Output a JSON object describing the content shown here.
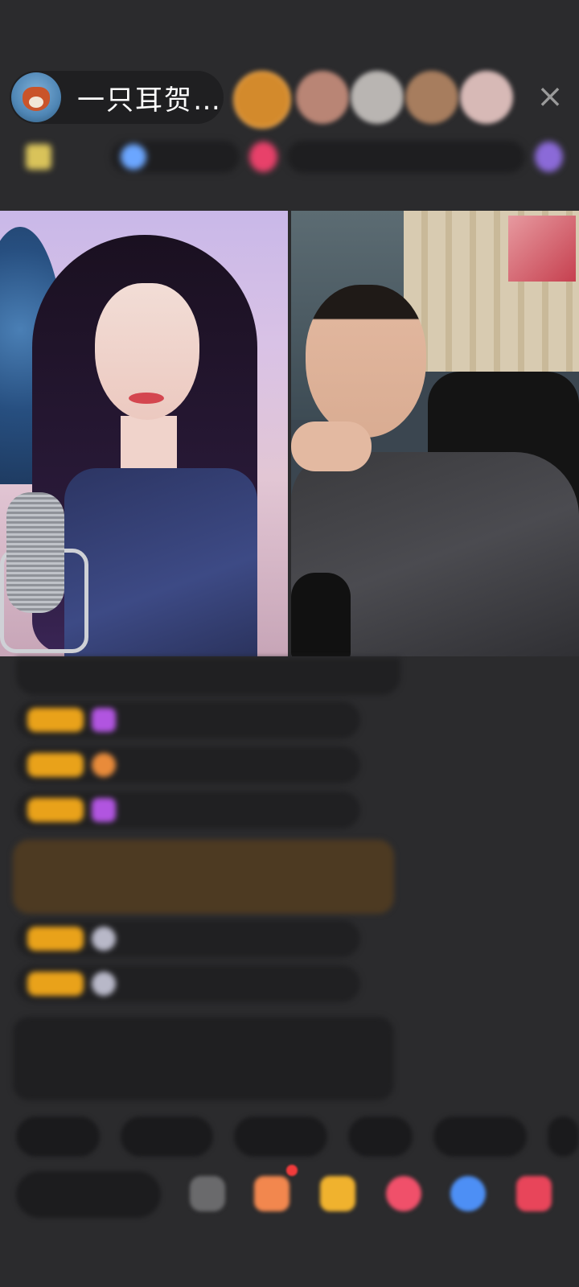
{
  "header": {
    "host_name": "一只耳贺…",
    "close_label": "×",
    "viewers": [
      {
        "name": "viewer-1",
        "color": "#d38a2c"
      },
      {
        "name": "viewer-2",
        "color": "#b98575"
      },
      {
        "name": "viewer-3",
        "color": "#b9b5b2"
      },
      {
        "name": "viewer-4",
        "color": "#a77d5e"
      },
      {
        "name": "viewer-5",
        "color": "#d7b9b6"
      }
    ]
  },
  "colors": {
    "background": "#2b2b2d",
    "badge_gold": "#e9a21a",
    "chat_green": "#95d86a",
    "chat_brown_bg": "#4d3a22"
  },
  "icons": {
    "close": "close-icon",
    "emoji": "emoji-icon",
    "gift_box": "gift-box-icon",
    "treasure": "treasure-icon",
    "heart_gift": "heart-gift-icon",
    "game": "game-controller-icon",
    "more_gifts": "gift-grid-icon"
  }
}
